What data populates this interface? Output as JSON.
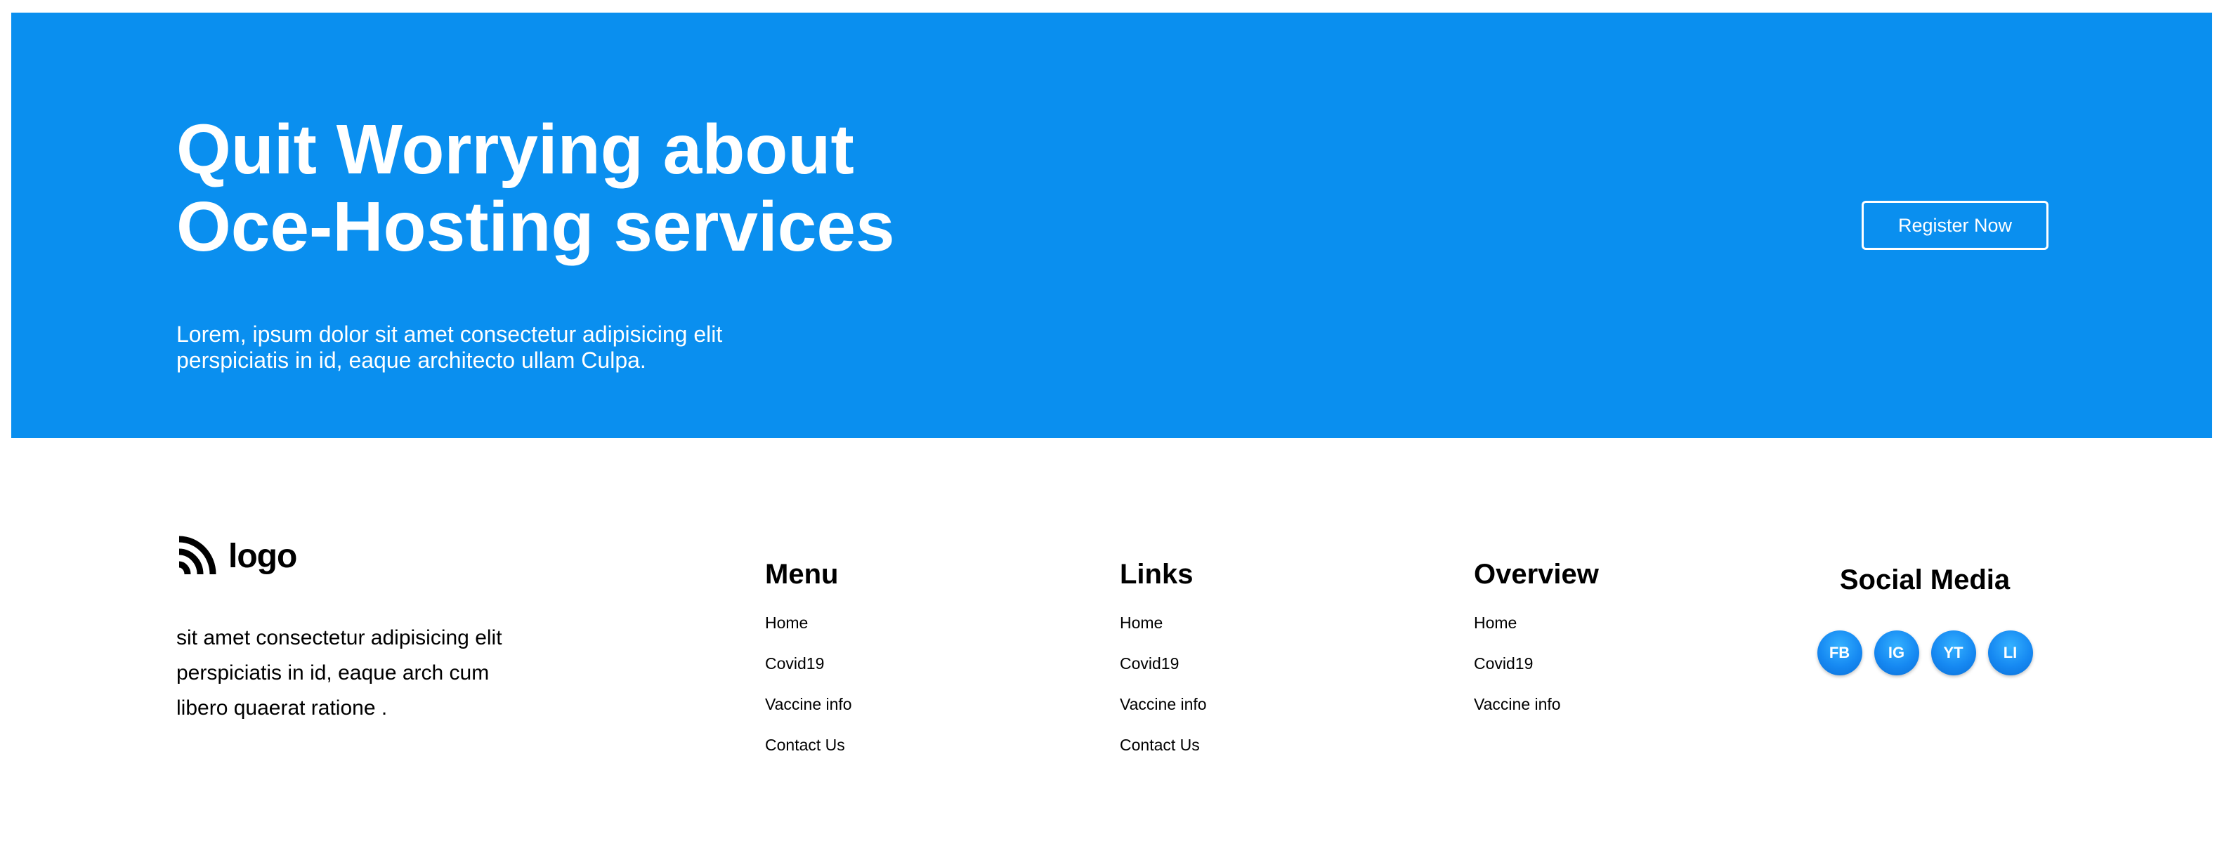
{
  "hero": {
    "title_line1": "Quit Worrying about",
    "title_line2": "Oce-Hosting services",
    "text_line1": "Lorem, ipsum dolor sit amet consectetur adipisicing elit",
    "text_line2": "perspiciatis in id, eaque architecto ullam Culpa.",
    "register_label": "Register Now",
    "background_color": "#0a8fef"
  },
  "footer": {
    "brand": {
      "name": "logo",
      "icon": "logo-wave-icon",
      "text_line1": "sit amet consectetur adipisicing elit",
      "text_line2": "perspiciatis in id, eaque arch cum",
      "text_line3": "libero quaerat ratione ."
    },
    "menu": {
      "title": "Menu",
      "items": [
        "Home",
        "Covid19",
        "Vaccine info",
        "Contact Us"
      ]
    },
    "links": {
      "title": "Links",
      "items": [
        "Home",
        "Covid19",
        "Vaccine info",
        "Contact Us"
      ]
    },
    "overview": {
      "title": "Overview",
      "items": [
        "Home",
        "Covid19",
        "Vaccine info"
      ]
    },
    "social": {
      "title": "Social Media",
      "icons": [
        "FB",
        "IG",
        "YT",
        "LI"
      ]
    }
  }
}
